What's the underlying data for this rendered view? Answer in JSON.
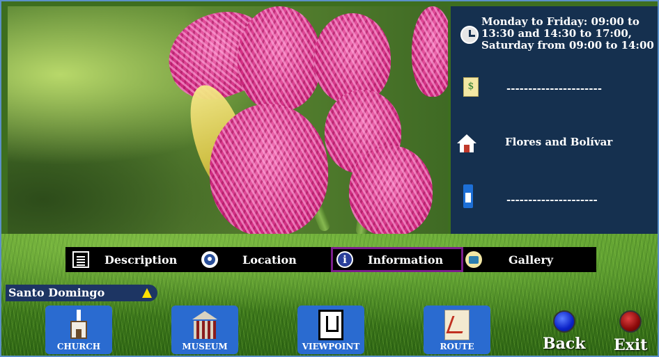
{
  "info_panel": {
    "hours": "Monday to Friday: 09:00 to 13:30 and 14:30 to 17:00, Saturday from 09:00 to 14:00",
    "price": "----------------------",
    "address": "Flores and Bolívar",
    "phone": "---------------------",
    "icons": [
      "clock-icon",
      "money-icon",
      "house-icon",
      "phone-icon"
    ]
  },
  "tabs": [
    {
      "label": "Description",
      "icon": "document-icon",
      "active": false
    },
    {
      "label": "Location",
      "icon": "map-pin-icon",
      "active": false
    },
    {
      "label": "Information",
      "icon": "info-icon",
      "active": true
    },
    {
      "label": "Gallery",
      "icon": "camera-icon",
      "active": false
    }
  ],
  "city": {
    "label": "Santo Domingo",
    "icon": "warning-triangle-icon"
  },
  "nav_buttons": [
    {
      "label": "CHURCH",
      "icon": "church-icon"
    },
    {
      "label": "MUSEUM",
      "icon": "museum-icon"
    },
    {
      "label": "VIEWPOINT",
      "icon": "viewpoint-icon"
    },
    {
      "label": "ROUTE",
      "icon": "route-icon"
    }
  ],
  "actions": {
    "back": "Back",
    "exit": "Exit"
  },
  "colors": {
    "panel_bg": "#15304f",
    "tab_bar_bg": "#000000",
    "active_tab_border": "#7b1d8c",
    "nav_button_bg": "#2a6bd0",
    "back_button": "#0b22c8",
    "exit_button": "#8a0a0a",
    "city_label_bg": "#1d3563"
  }
}
